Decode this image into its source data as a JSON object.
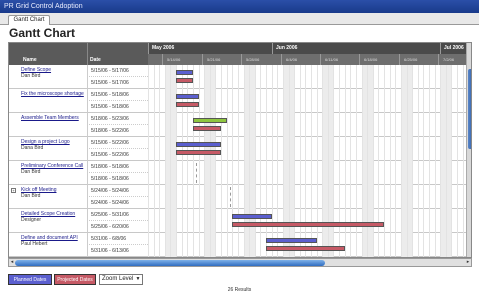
{
  "window": {
    "title": "PR Grid Control Adoption"
  },
  "tabs": [
    {
      "label": "Gantt Chart",
      "active": true
    }
  ],
  "page": {
    "title": "Gantt Chart"
  },
  "columns": {
    "name": "Name",
    "date": "Date"
  },
  "months": [
    "May 2006",
    "Jun 2006",
    "Jul 2006"
  ],
  "weeks": [
    "5/14/06",
    "5/21/06",
    "5/28/06",
    "6/4/06",
    "6/11/06",
    "6/18/06",
    "6/25/06",
    "7/2/06"
  ],
  "tasks": [
    {
      "name": "Define Scope",
      "owner": "Dan Bird",
      "planned": "5/15/06 - 5/17/06",
      "projected": "5/15/06 - 5/17/06",
      "expander": "",
      "bars": {
        "planned": [
          "5/15/06",
          "5/17/06"
        ],
        "projected": [
          "5/15/06",
          "5/17/06"
        ]
      }
    },
    {
      "name": "Fix the microscope shortage",
      "owner": "",
      "planned": "5/15/06 - 5/18/06",
      "projected": "5/15/06 - 5/18/06",
      "expander": "",
      "bars": {
        "planned": [
          "5/15/06",
          "5/18/06"
        ],
        "projected": [
          "5/15/06",
          "5/18/06"
        ]
      }
    },
    {
      "name": "Assemble Team Members",
      "owner": "",
      "planned": "5/18/06 - 5/23/06",
      "projected": "5/18/06 - 5/22/06",
      "expander": "",
      "bars": {
        "progress": [
          "5/18/06",
          "5/23/06"
        ],
        "projected": [
          "5/18/06",
          "5/22/06"
        ]
      }
    },
    {
      "name": "Design a project Logo",
      "owner": "Dana Bird",
      "planned": "5/15/06 - 5/22/06",
      "projected": "5/15/06 - 5/22/06",
      "expander": "",
      "bars": {
        "planned": [
          "5/15/06",
          "5/22/06"
        ],
        "projected": [
          "5/15/06",
          "5/22/06"
        ]
      }
    },
    {
      "name": "Preliminary Conference Call",
      "owner": "Dan Bird",
      "planned": "5/18/06 - 5/18/06",
      "projected": "5/18/06 - 5/18/06",
      "expander": "",
      "bars": {
        "milestone": "5/18/06"
      }
    },
    {
      "name": "Kick off Meeting",
      "owner": "Dan Bird",
      "planned": "5/24/06 - 5/24/06",
      "projected": "5/24/06 - 5/24/06",
      "expander": "+",
      "bars": {
        "milestone": "5/24/06"
      }
    },
    {
      "name": "Detailed Scope Creation",
      "owner": "Designer",
      "planned": "5/25/06 - 5/31/06",
      "projected": "5/25/06 - 6/20/06",
      "expander": "",
      "bars": {
        "planned": [
          "5/25/06",
          "5/31/06"
        ],
        "projected": [
          "5/25/06",
          "6/20/06"
        ]
      }
    },
    {
      "name": "Define and document API",
      "owner": "Paul Hebert",
      "planned": "5/31/06 - 6/8/06",
      "projected": "5/31/06 - 6/13/06",
      "expander": "",
      "bars": {
        "planned": [
          "5/31/06",
          "6/8/06"
        ],
        "projected": [
          "5/31/06",
          "6/13/06"
        ]
      }
    },
    {
      "name": "Phase 1 Implementation",
      "owner": "Paul Hebert",
      "planned": "6/12/06 - 6/26/06",
      "projected": "6/12/06 - 6/26/06",
      "expander": "",
      "bars": {
        "planned": [
          "6/12/06",
          "6/26/06"
        ],
        "projected": [
          "6/12/06",
          "6/26/06"
        ]
      }
    }
  ],
  "legend": {
    "planned": "Planned Dates",
    "projected": "Projected Dates"
  },
  "zoom": {
    "label": "Zoom Level"
  },
  "footer": {
    "results": "26 Results"
  },
  "colors": {
    "planned": "#5b5fcf",
    "projected": "#c65a66",
    "progress": "#8ec63f",
    "header": "#5a5a5a",
    "titlebar": "#1f3f92"
  }
}
